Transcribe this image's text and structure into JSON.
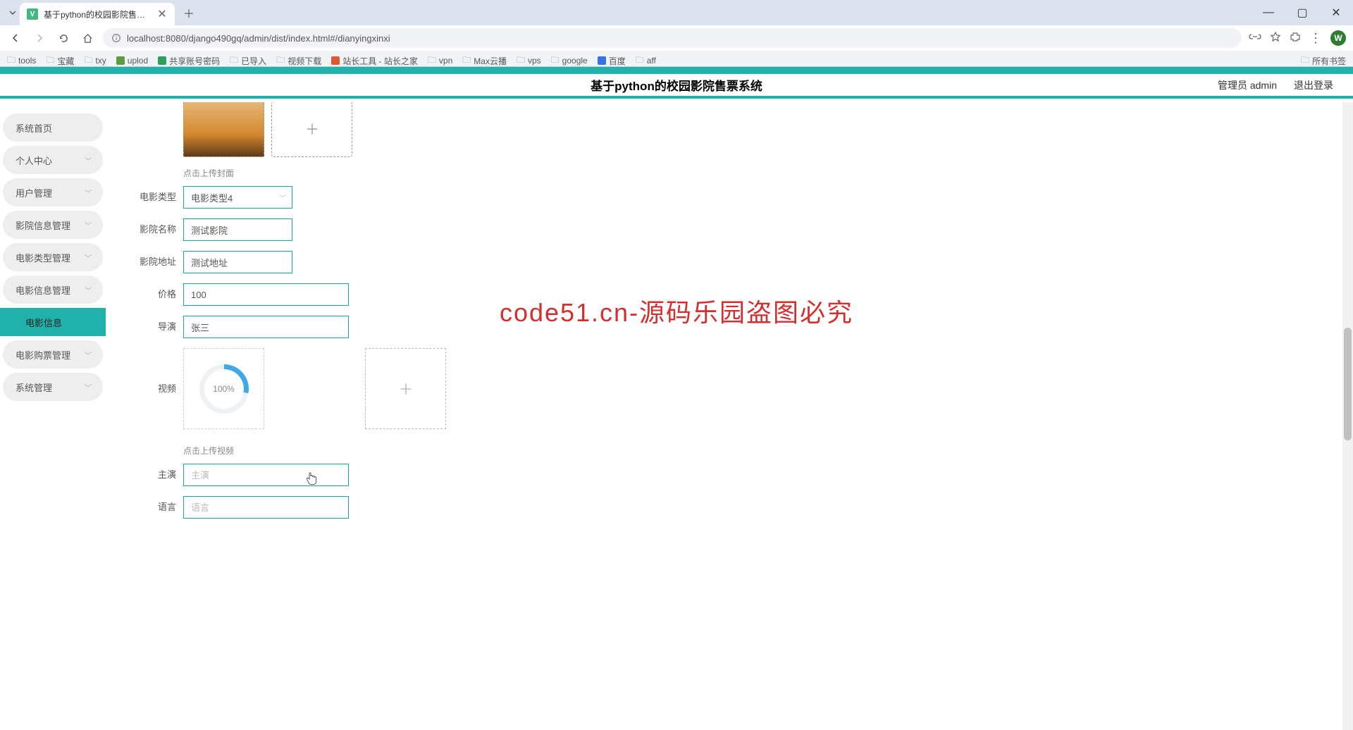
{
  "browser": {
    "tab_title": "基于python的校园影院售票系",
    "url_full": "localhost:8080/django490gq/admin/dist/index.html#/dianyingxinxi",
    "avatar_letter": "W",
    "bookmarks": [
      "tools",
      "宝藏",
      "txy",
      "uplod",
      "共享账号密码",
      "已导入",
      "视频下载",
      "站长工具 - 站长之家",
      "vpn",
      "Max云播",
      "vps",
      "google",
      "百度",
      "aff"
    ],
    "all_bookmarks_label": "所有书签"
  },
  "header": {
    "app_title": "基于python的校园影院售票系统",
    "admin_label": "管理员 admin",
    "logout_label": "退出登录"
  },
  "sidebar": {
    "items": [
      {
        "label": "系统首页",
        "expandable": false
      },
      {
        "label": "个人中心",
        "expandable": true
      },
      {
        "label": "用户管理",
        "expandable": true
      },
      {
        "label": "影院信息管理",
        "expandable": true
      },
      {
        "label": "电影类型管理",
        "expandable": true
      },
      {
        "label": "电影信息管理",
        "expandable": true
      },
      {
        "label": "电影信息",
        "expandable": false,
        "active": true
      },
      {
        "label": "电影购票管理",
        "expandable": true
      },
      {
        "label": "系统管理",
        "expandable": true
      }
    ]
  },
  "form": {
    "cover_hint": "点击上传封面",
    "movie_type_label": "电影类型",
    "movie_type_value": "电影类型4",
    "cinema_name_label": "影院名称",
    "cinema_name_value": "测试影院",
    "cinema_addr_label": "影院地址",
    "cinema_addr_value": "测试地址",
    "price_label": "价格",
    "price_value": "100",
    "director_label": "导演",
    "director_value": "张三",
    "video_label": "视频",
    "video_progress_text": "100%",
    "video_hint": "点击上传视频",
    "actor_label": "主演",
    "actor_placeholder": "主演",
    "language_label": "语言",
    "language_placeholder": "语言"
  },
  "watermark_bold": "code51.cn-源码乐园盗图必究"
}
